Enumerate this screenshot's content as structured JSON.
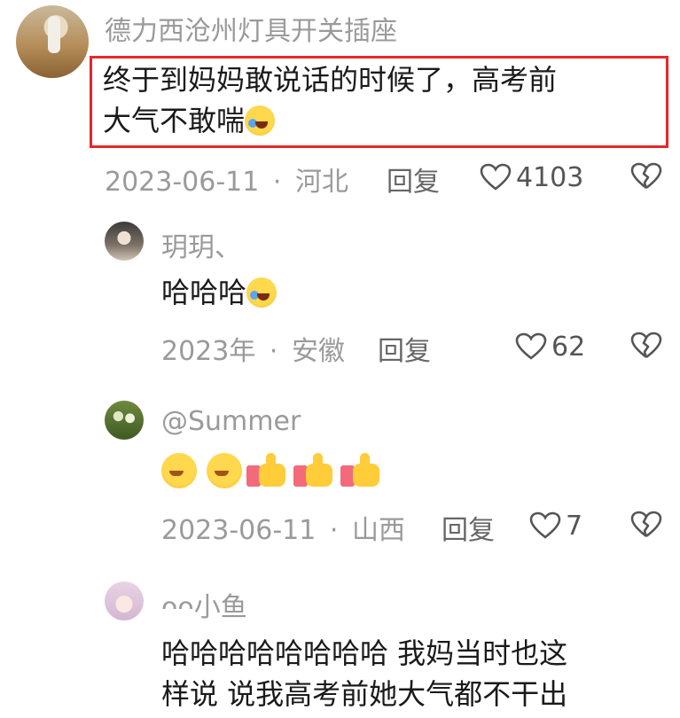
{
  "comments": [
    {
      "username": "德力西沧州灯具开关插座",
      "text": "终于到妈妈敢说话的时候了，高考前",
      "text_line2": "大气不敢喘",
      "emoji": "face-with-tears-of-joy",
      "date": "2023-06-11",
      "location": "河北",
      "reply_label": "回复",
      "likes": "4103"
    }
  ],
  "replies": [
    {
      "username": "玥玥、",
      "text": "哈哈哈",
      "emoji": "face-with-tears-of-joy",
      "date": "2023年",
      "location": "安徽",
      "reply_label": "回复",
      "likes": "62"
    },
    {
      "username": "@Summer",
      "emojis": [
        "face-with-hand-over-mouth",
        "face-with-hand-over-mouth",
        "thumbs-up",
        "thumbs-up",
        "thumbs-up"
      ],
      "date": "2023-06-11",
      "location": "山西",
      "reply_label": "回复",
      "likes": "7"
    },
    {
      "username": "ᴖᴖ小鱼",
      "text_line1": "哈哈哈哈哈哈哈哈 我妈当时也这",
      "text_line2": "样说 说我高考前她大气都不干出"
    }
  ],
  "separator": "·",
  "colors": {
    "highlight": "#e8262a",
    "meta": "#9a9a9a",
    "text": "#1a1a1a"
  }
}
